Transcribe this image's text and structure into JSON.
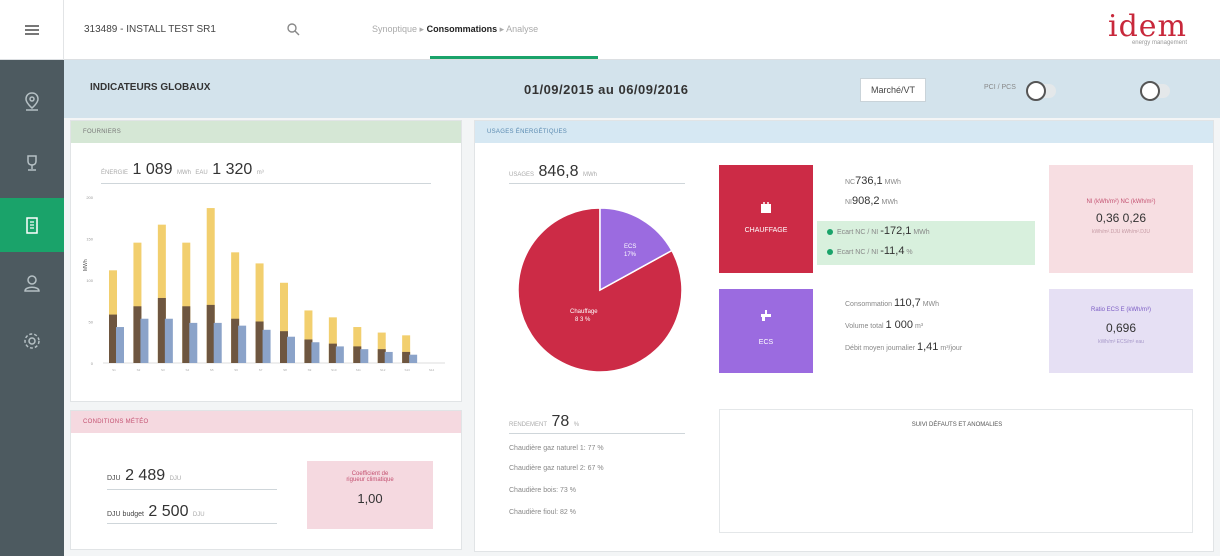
{
  "topbar": {
    "site_name": "313489 - INSTALL TEST SR1",
    "breadcrumb_prefix": "Synoptique ▸",
    "breadcrumb_active": "Consommations",
    "breadcrumb_suffix": "▸ Analyse",
    "logo_text": "idem",
    "logo_tagline": "energy management"
  },
  "sidebar": {
    "items": [
      {
        "icon": "location-pin-icon",
        "active": false
      },
      {
        "icon": "trophy-icon",
        "active": false
      },
      {
        "icon": "building-icon",
        "active": true
      },
      {
        "icon": "user-icon",
        "active": false
      },
      {
        "icon": "gear-icon",
        "active": false
      }
    ]
  },
  "header": {
    "title": "INDICATEURS GLOBAUX",
    "date_range": "01/09/2015 au 06/09/2016",
    "market_button": "Marché/VT",
    "pci_label": "PCI / PCS",
    "pci_toggle_on": false,
    "right_toggle_on": false
  },
  "conso": {
    "panel_title": "FOURNIERS",
    "energie_label": "ÉNERGIE",
    "energie_value": "1 089",
    "energie_unit": "MWh",
    "eau_label": "EAU",
    "eau_value": "1 320",
    "eau_unit": "m³",
    "chart_axis_unit": "MWh"
  },
  "chart_data": {
    "type": "bar",
    "categories": [
      "S1",
      "S2",
      "S3",
      "S4",
      "S5",
      "S6",
      "S7",
      "S8",
      "S9",
      "S10",
      "S11",
      "S12",
      "S13",
      "S14"
    ],
    "series": [
      {
        "color": "#f2cf6e",
        "values": [
          67,
          87,
          100,
          87,
          112,
          80,
          72,
          58,
          38,
          33,
          26,
          22,
          20,
          0
        ]
      },
      {
        "color": "#6e5640",
        "values": [
          35,
          41,
          47,
          41,
          42,
          32,
          30,
          23,
          17,
          14,
          12,
          10,
          8,
          0
        ]
      },
      {
        "color": "#8ba3c9",
        "values": [
          26,
          32,
          32,
          29,
          29,
          27,
          24,
          19,
          15,
          12,
          10,
          8,
          6,
          0
        ]
      }
    ],
    "yticks": [
      "200",
      "150",
      "100",
      "50",
      "0"
    ],
    "ylim": [
      0,
      120
    ],
    "colors": {
      "yellow": "#f2cf6e",
      "brown": "#6e5640",
      "blue": "#8ba3c9"
    }
  },
  "conditions": {
    "panel_title": "CONDITIONS MÉTÉO",
    "dju_label": "DJU",
    "dju_value": "2 489",
    "dju_unit": "DJU",
    "dju_budget_label": "DJU budget",
    "dju_budget_value": "2 500",
    "dju_budget_unit": "DJU",
    "coef_label_1": "Coefficient de",
    "coef_label_2": "rigueur climatique",
    "coef_value": "1,00"
  },
  "usages": {
    "panel_title": "USAGES ÉNERGÉTIQUES",
    "total_label": "USAGES",
    "total_value": "846,8",
    "total_unit": "MWh",
    "pie": {
      "slices": [
        {
          "label": "Chauffage",
          "pct": 83,
          "pct_text": "8 3 %",
          "color": "#cc2b46"
        },
        {
          "label": "ECS",
          "pct": 17,
          "pct_text": "17%",
          "color": "#9b6be0"
        }
      ]
    },
    "chauffage": {
      "name": "CHAUFFAGE",
      "color": "#cc2b46",
      "line1_label": "NC",
      "line1_value": "736,1",
      "line1_unit": "MWh",
      "line2_label": "NI",
      "line2_value": "908,2",
      "line2_unit": "MWh",
      "ecart1_label": "Ecart NC / NI",
      "ecart1_value": "-172,1",
      "ecart1_unit": "MWh",
      "ecart2_label": "Ecart NC / NI",
      "ecart2_value": "-11,4",
      "ecart2_unit": "%",
      "ratio_labels": "NI (kWh/m²)  NC (kWh/m²)",
      "ratio_values": "0,36 0,26",
      "ratio_sub": "kWh/m².DJU  kWh/m².DJU"
    },
    "ecs": {
      "name": "ECS",
      "color": "#9b6be0",
      "conso_label": "Consommation",
      "conso_value": "110,7",
      "conso_unit": "MWh",
      "volume_label": "Volume total",
      "volume_value": "1 000",
      "volume_unit": "m³",
      "debit_label": "Débit moyen journalier",
      "debit_value": "1,41",
      "debit_unit": "m³/jour",
      "ratio_labels": "Ratio ECS  E (kWh/m³)",
      "ratio_value": "0,696",
      "ratio_sub": "kWh/m³ ECS/m³ eau"
    },
    "rendement_label": "RENDEMENT",
    "rendement_value": "78",
    "rendement_unit": "%",
    "rendement_lines": [
      "Chaudière gaz naturel 1: 77 %",
      "Chaudière gaz naturel 2: 67 %",
      "Chaudière bois: 73 %",
      "Chaudière fioul: 82 %"
    ],
    "defaults_title": "SUIVI DÉFAUTS ET ANOMALIES"
  }
}
